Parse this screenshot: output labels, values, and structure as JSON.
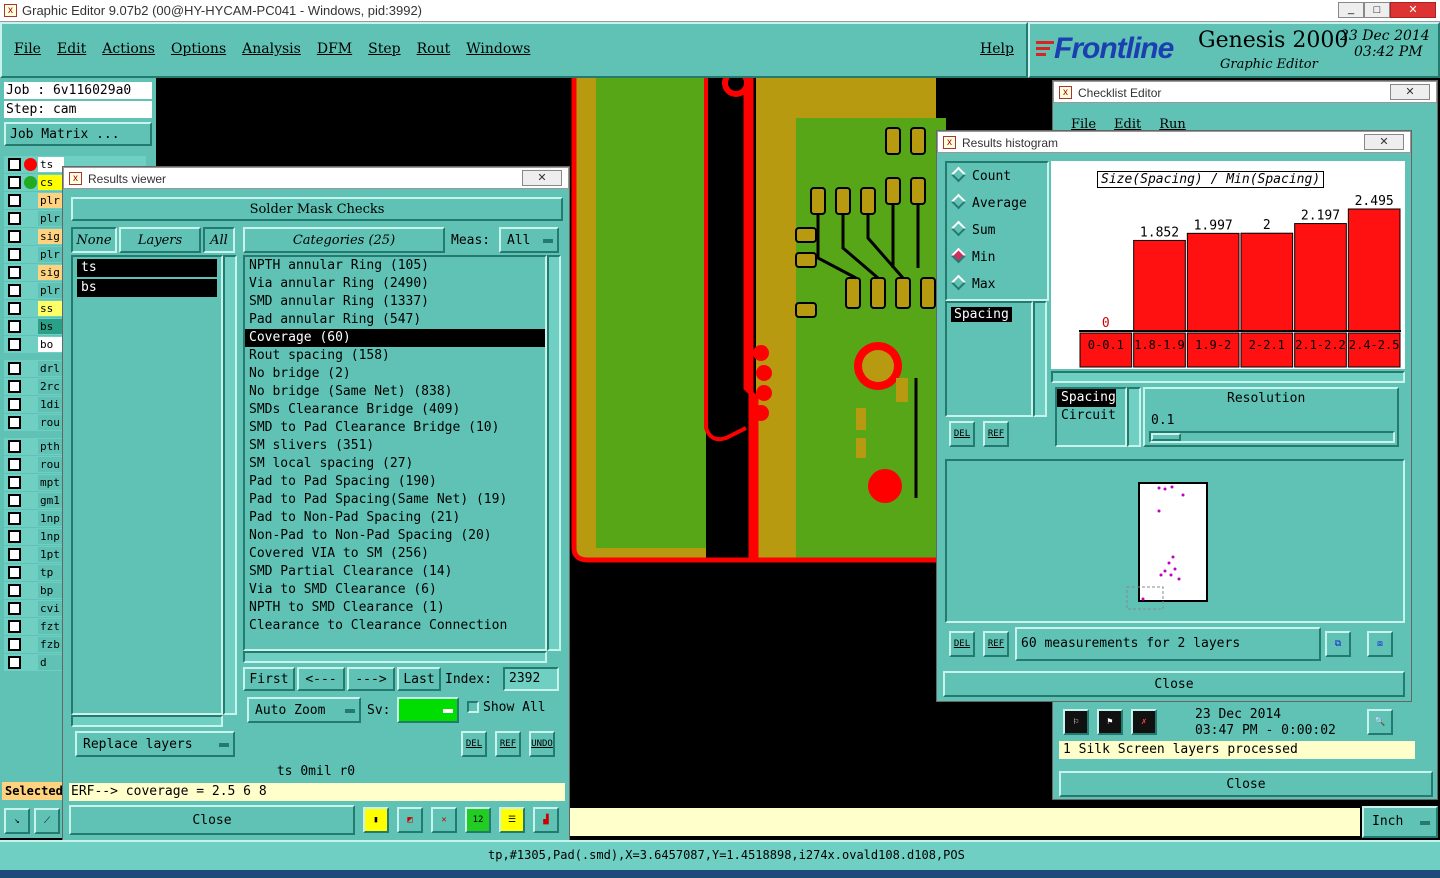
{
  "app": {
    "title": "Graphic Editor 9.07b2 (00@HY-HYCAM-PC041 - Windows, pid:3992)",
    "menus": [
      "File",
      "Edit",
      "Actions",
      "Options",
      "Analysis",
      "DFM",
      "Step",
      "Rout",
      "Windows"
    ],
    "help": "Help",
    "brand": "Frontline",
    "product": "Genesis 2000",
    "subtitle": "Graphic Editor",
    "date": "23 Dec 2014",
    "time": "03:42 PM",
    "win_min": "_",
    "win_max": "□",
    "win_close": "✕"
  },
  "left": {
    "job": "Job : 6v116029a0",
    "step": "Step: cam",
    "job_matrix": "Job Matrix ...",
    "selected": "Selected",
    "layers": [
      {
        "name": "ts",
        "bg": "#ffffff",
        "dot": "#ff0000"
      },
      {
        "name": "cs",
        "bg": "#ffff00",
        "dot": "#22aa22"
      },
      {
        "name": "plr",
        "bg": "#ffd27f"
      },
      {
        "name": "plr",
        "bg": "#5fc2b5"
      },
      {
        "name": "sig",
        "bg": "#ffd27f"
      },
      {
        "name": "plr",
        "bg": "#5fc2b5"
      },
      {
        "name": "sig",
        "bg": "#ffd27f"
      },
      {
        "name": "plr",
        "bg": "#5fc2b5"
      },
      {
        "name": "ss",
        "bg": "#ffff66"
      },
      {
        "name": "bs",
        "bg": "#2aa088"
      },
      {
        "name": "bo",
        "bg": "#ffffff"
      },
      {
        "name": "drl",
        "bg": "#5fc2b5"
      },
      {
        "name": "2rc",
        "bg": "#5fc2b5"
      },
      {
        "name": "1di",
        "bg": "#5fc2b5"
      },
      {
        "name": "rou",
        "bg": "#5fc2b5"
      },
      {
        "name": "pth",
        "bg": "#5fc2b5"
      },
      {
        "name": "rou",
        "bg": "#5fc2b5"
      },
      {
        "name": "mpt",
        "bg": "#5fc2b5"
      },
      {
        "name": "gm1",
        "bg": "#5fc2b5"
      },
      {
        "name": "1np",
        "bg": "#5fc2b5"
      },
      {
        "name": "1np",
        "bg": "#5fc2b5"
      },
      {
        "name": "1pt",
        "bg": "#5fc2b5"
      },
      {
        "name": "tp",
        "bg": "#5fc2b5"
      },
      {
        "name": "bp",
        "bg": "#5fc2b5"
      },
      {
        "name": "cvi",
        "bg": "#5fc2b5"
      },
      {
        "name": "fzt",
        "bg": "#5fc2b5"
      },
      {
        "name": "fzb",
        "bg": "#5fc2b5"
      },
      {
        "name": "d",
        "bg": "#5fc2b5"
      }
    ]
  },
  "results_viewer": {
    "title": "Results viewer",
    "header": "Solder Mask Checks",
    "btn_none": "None",
    "btn_layers": "Layers",
    "btn_all": "All",
    "layers": [
      "ts",
      "bs"
    ],
    "categories_label": "Categories (25)",
    "meas_label": "Meas:",
    "meas_value": "All",
    "categories": [
      "NPTH annular Ring (105)",
      "Via annular Ring (2490)",
      "SMD annular Ring (1337)",
      "Pad annular Ring (547)",
      "Coverage (60)",
      "Rout spacing (158)",
      "No bridge (2)",
      "No bridge (Same Net) (838)",
      "SMDs Clearance Bridge (409)",
      "SMD to Pad Clearance Bridge (10)",
      "SM slivers (351)",
      "SM local spacing (27)",
      "Pad to Pad Spacing (190)",
      "Pad to Pad Spacing(Same Net) (19)",
      "Pad to Non-Pad Spacing (21)",
      "Non-Pad to Non-Pad Spacing (20)",
      "Covered VIA to SM (256)",
      "SMD Partial Clearance (14)",
      "Via to SMD Clearance (6)",
      "NPTH to SMD Clearance (1)",
      "Clearance to Clearance Connection"
    ],
    "selected_index": 4,
    "nav_first": "First",
    "nav_prev": "<---",
    "nav_next": "--->",
    "nav_last": "Last",
    "index_label": "Index:",
    "index_value": "2392",
    "auto_zoom": "Auto Zoom",
    "sv_label": "Sv:",
    "show_all": "Show All",
    "replace_layers": "Replace layers",
    "del": "DEL",
    "ref": "REF",
    "undo": "UNDO",
    "info": "ts 0mil  r0",
    "erf": "ERF--> coverage = 2.5 6 8",
    "close": "Close"
  },
  "checklist": {
    "title": "Checklist Editor",
    "menus": [
      "File",
      "Edit",
      "Run"
    ],
    "time1": "23 Dec 2014",
    "time2": "03:47 PM - 0:00:02",
    "status": "1 Silk Screen layers processed",
    "close": "Close"
  },
  "histogram": {
    "title": "Results histogram",
    "options": [
      "Count",
      "Average",
      "Sum",
      "Min",
      "Max"
    ],
    "selected_option": "Min",
    "list_item": "Spacing",
    "del": "DEL",
    "ref": "REF",
    "chart_title": "Size(Spacing) / Min(Spacing)",
    "resolution_label": "Resolution",
    "resolution_value": "0.1",
    "list2": [
      "Spacing",
      "Circuit"
    ],
    "measurements": "60 measurements for 2 layers",
    "close": "Close"
  },
  "chart_data": {
    "type": "bar",
    "title": "Size(Spacing) / Min(Spacing)",
    "categories": [
      "0-0.1",
      "1.8-1.9",
      "1.9-2",
      "2-2.1",
      "2.1-2.2",
      "2.4-2.5"
    ],
    "values": [
      0,
      1.852,
      1.997,
      2,
      2.197,
      2.495
    ],
    "value_labels": [
      "0",
      "1.852",
      "1.997",
      "2",
      "2.197",
      "2.495"
    ],
    "bar_color": "#ff1111",
    "ylim": [
      0,
      2.6
    ]
  },
  "status_bar": {
    "text": "tp,#1305,Pad(.smd),X=3.6457087,Y=1.4518898,i274x.ovald108.d108,POS",
    "units": "Inch"
  },
  "colors": {
    "panel": "#5fc2b5",
    "green": "#56a618",
    "gold": "#b89a10",
    "red": "#ff0000"
  }
}
